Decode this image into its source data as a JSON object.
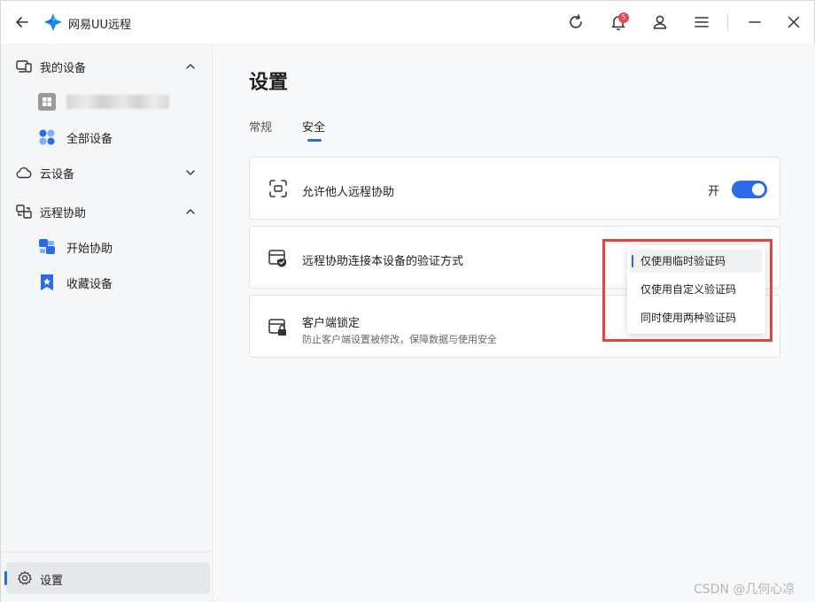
{
  "app": {
    "title": "网易UU远程"
  },
  "titlebar": {
    "notification_count": "5"
  },
  "sidebar": {
    "my_devices": {
      "label": "我的设备"
    },
    "all_devices": {
      "label": "全部设备"
    },
    "cloud_devices": {
      "label": "云设备"
    },
    "remote_assist": {
      "label": "远程协助"
    },
    "start_assist": {
      "label": "开始协助"
    },
    "favorite_devices": {
      "label": "收藏设备"
    },
    "settings": {
      "label": "设置"
    }
  },
  "main": {
    "title": "设置",
    "tabs": [
      {
        "label": "常规",
        "active": false
      },
      {
        "label": "安全",
        "active": true
      }
    ],
    "cards": {
      "allow_remote": {
        "title": "允许他人远程协助",
        "toggle_label": "开",
        "toggle_on": true
      },
      "verify_method": {
        "title": "远程协助连接本设备的验证方式"
      },
      "client_lock": {
        "title": "客户端锁定",
        "subtitle": "防止客户端设置被修改，保障数据与使用安全"
      }
    }
  },
  "dropdown": {
    "options": [
      {
        "label": "仅使用临时验证码",
        "selected": true
      },
      {
        "label": "仅使用自定义验证码",
        "selected": false
      },
      {
        "label": "同时使用两种验证码",
        "selected": false
      }
    ]
  },
  "watermark": {
    "text": "CSDN @几何心凉"
  },
  "colors": {
    "accent": "#2a6bea",
    "highlight": "#e8403a",
    "badge": "#f2414a"
  }
}
